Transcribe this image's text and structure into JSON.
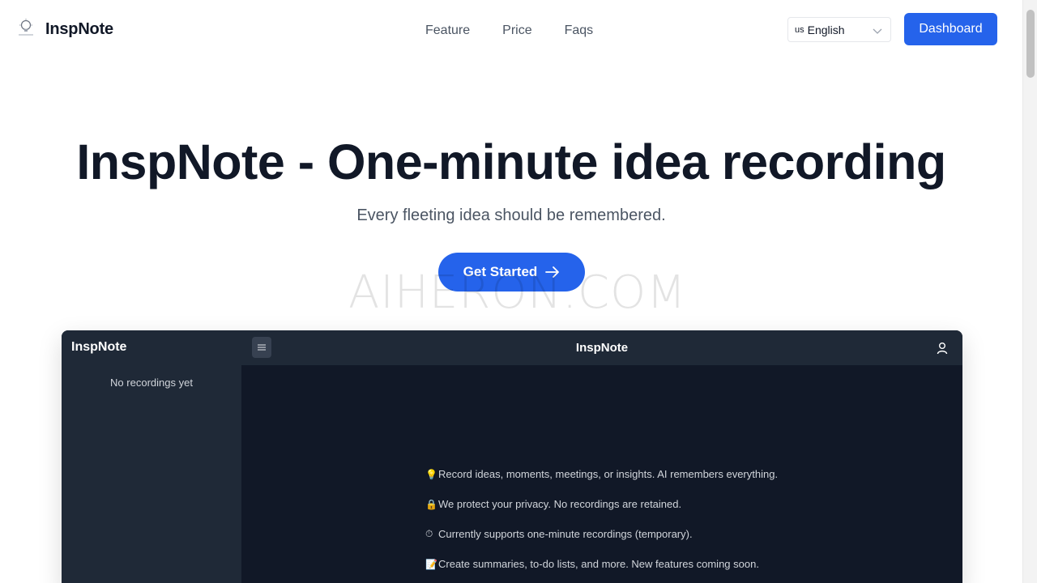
{
  "header": {
    "brand": "InspNote",
    "nav": [
      "Feature",
      "Price",
      "Faqs"
    ],
    "language": {
      "flag": "us",
      "label": "English"
    },
    "dashboard_label": "Dashboard"
  },
  "hero": {
    "title": "InspNote - One-minute idea recording",
    "subtitle": "Every fleeting idea should be remembered.",
    "cta_label": "Get Started"
  },
  "watermark": "AIHERON.COM",
  "preview": {
    "brand": "InspNote",
    "title": "InspNote",
    "sidebar_empty": "No recordings yet",
    "features": [
      {
        "icon": "💡",
        "text": "Record ideas, moments, meetings, or insights. AI remembers everything."
      },
      {
        "icon": "🔒",
        "text": "We protect your privacy. No recordings are retained."
      },
      {
        "icon": "⏱",
        "text": "Currently supports one-minute recordings (temporary)."
      },
      {
        "icon": "📝",
        "text": "Create summaries, to-do lists, and more. New features coming soon."
      }
    ]
  },
  "colors": {
    "accent": "#2563eb",
    "dark_bg": "#111827",
    "panel_bg": "#1f2937"
  }
}
